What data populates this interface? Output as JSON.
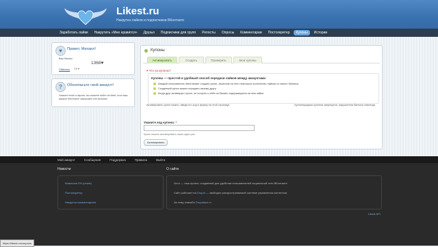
{
  "header": {
    "title": "Likest.ru",
    "subtitle": "Накрутка лайков и подписчиков ВКонтакте"
  },
  "nav": {
    "items": [
      "Заработать лайки",
      "Накрутить «Мне нравится»",
      "Друзья",
      "Подписчики для групп",
      "Репосты",
      "Опросы",
      "Комментарии",
      "Постсекретер",
      "Купоны",
      "Истории"
    ],
    "active_index": 8
  },
  "sidebar": {
    "greeting": "Привет, Михаил!",
    "balance_label": "Ваш баланс:",
    "balance_value": "1368♥",
    "currency_label": "Обменять",
    "rate_text": "1:5 ♥",
    "secure_title": "Обезопасьте свой аккаунт!",
    "secure_text": "Укажите email и пароль, вы сможете войти на likest, если ваш аккаунт ВКонтакте заморожен или взломан."
  },
  "main": {
    "title": "Купоны",
    "tabs": [
      "Активировать",
      "Создать",
      "Проверить",
      "Мои купоны"
    ],
    "active_tab": 0,
    "what_link": "▾ Что за купоны?",
    "info_heading": "Купоны — простой и удобный способ передачи лайков между аккаунтами",
    "bullets": [
      "Каждый пользователь likest может создать купон, зачислив на него некоторое количество лайков со своего баланса",
      "Созданный купон можно передать своему другу",
      "Когда друг активирует купон, он получит к себе на баланс содержащиеся на нем лайки"
    ],
    "activate_note": "Активировать купон можно, введя его код в форму на этой странице.",
    "sale_note": "Купля/продажа купонов запрещена, нарушители банятся навсегда",
    "code_label": "Укажите код купона:",
    "code_required": "*",
    "code_value": "",
    "code_hint": "Купон можно активировать лишь один раз",
    "activate_button": "Активировать"
  },
  "footer": {
    "nav": [
      "Мой аккаунт",
      "Сообщения",
      "Поддержка",
      "Правила",
      "Выйти"
    ],
    "news_title": "Новости",
    "news_items": [
      "Комиссия 0% (отзив)",
      "Постсекретер",
      "Накрутка комментариев"
    ],
    "about_title": "О сайте",
    "about_1_link": "likest",
    "about_1_text": " — наш проект, созданный для удобства пользователей социальной сети ВКонтакте",
    "about_2_prefix": "Сайт работает на ",
    "about_2_link": "Drupal",
    "about_2_text": " — свободно распространяемой системе управления контентом.",
    "about_3_prefix": "За тему спасибо ",
    "about_3_link": "Drupalace.ru",
    "copyright": "Likest API"
  },
  "status_bar": {
    "url": "https://likest.ru/coupons"
  }
}
